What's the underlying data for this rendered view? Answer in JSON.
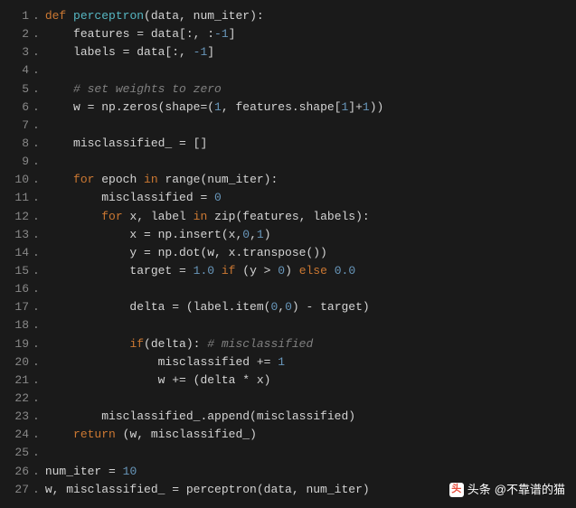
{
  "lines": [
    {
      "n": "1",
      "tokens": [
        {
          "t": "def ",
          "c": "keyword"
        },
        {
          "t": "perceptron",
          "c": "def-name"
        },
        {
          "t": "(data, num_iter):",
          "c": "plain"
        }
      ]
    },
    {
      "n": "2",
      "tokens": [
        {
          "t": "    features = data[:, :",
          "c": "plain"
        },
        {
          "t": "-1",
          "c": "number"
        },
        {
          "t": "]",
          "c": "plain"
        }
      ]
    },
    {
      "n": "3",
      "tokens": [
        {
          "t": "    labels = data[:, ",
          "c": "plain"
        },
        {
          "t": "-1",
          "c": "number"
        },
        {
          "t": "]",
          "c": "plain"
        }
      ]
    },
    {
      "n": "4",
      "tokens": []
    },
    {
      "n": "5",
      "tokens": [
        {
          "t": "    ",
          "c": "plain"
        },
        {
          "t": "# set weights to zero",
          "c": "comment"
        }
      ]
    },
    {
      "n": "6",
      "tokens": [
        {
          "t": "    w = np.zeros(shape=(",
          "c": "plain"
        },
        {
          "t": "1",
          "c": "number"
        },
        {
          "t": ", features.shape[",
          "c": "plain"
        },
        {
          "t": "1",
          "c": "number"
        },
        {
          "t": "]+",
          "c": "plain"
        },
        {
          "t": "1",
          "c": "number"
        },
        {
          "t": "))",
          "c": "plain"
        }
      ]
    },
    {
      "n": "7",
      "tokens": []
    },
    {
      "n": "8",
      "tokens": [
        {
          "t": "    misclassified_ = []",
          "c": "plain"
        }
      ]
    },
    {
      "n": "9",
      "tokens": []
    },
    {
      "n": "10",
      "tokens": [
        {
          "t": "    ",
          "c": "plain"
        },
        {
          "t": "for",
          "c": "keyword"
        },
        {
          "t": " epoch ",
          "c": "plain"
        },
        {
          "t": "in",
          "c": "keyword"
        },
        {
          "t": " range(num_iter):",
          "c": "plain"
        }
      ]
    },
    {
      "n": "11",
      "tokens": [
        {
          "t": "        misclassified = ",
          "c": "plain"
        },
        {
          "t": "0",
          "c": "number"
        }
      ]
    },
    {
      "n": "12",
      "tokens": [
        {
          "t": "        ",
          "c": "plain"
        },
        {
          "t": "for",
          "c": "keyword"
        },
        {
          "t": " x, label ",
          "c": "plain"
        },
        {
          "t": "in",
          "c": "keyword"
        },
        {
          "t": " zip(features, labels):",
          "c": "plain"
        }
      ]
    },
    {
      "n": "13",
      "tokens": [
        {
          "t": "            x = np.insert(x,",
          "c": "plain"
        },
        {
          "t": "0",
          "c": "number"
        },
        {
          "t": ",",
          "c": "plain"
        },
        {
          "t": "1",
          "c": "number"
        },
        {
          "t": ")",
          "c": "plain"
        }
      ]
    },
    {
      "n": "14",
      "tokens": [
        {
          "t": "            y = np.dot(w, x.transpose())",
          "c": "plain"
        }
      ]
    },
    {
      "n": "15",
      "tokens": [
        {
          "t": "            target = ",
          "c": "plain"
        },
        {
          "t": "1.0",
          "c": "number"
        },
        {
          "t": " ",
          "c": "plain"
        },
        {
          "t": "if",
          "c": "keyword"
        },
        {
          "t": " (y > ",
          "c": "plain"
        },
        {
          "t": "0",
          "c": "number"
        },
        {
          "t": ") ",
          "c": "plain"
        },
        {
          "t": "else",
          "c": "keyword"
        },
        {
          "t": " ",
          "c": "plain"
        },
        {
          "t": "0.0",
          "c": "number"
        }
      ]
    },
    {
      "n": "16",
      "tokens": []
    },
    {
      "n": "17",
      "tokens": [
        {
          "t": "            delta = (label.item(",
          "c": "plain"
        },
        {
          "t": "0",
          "c": "number"
        },
        {
          "t": ",",
          "c": "plain"
        },
        {
          "t": "0",
          "c": "number"
        },
        {
          "t": ") - target)",
          "c": "plain"
        }
      ]
    },
    {
      "n": "18",
      "tokens": []
    },
    {
      "n": "19",
      "tokens": [
        {
          "t": "            ",
          "c": "plain"
        },
        {
          "t": "if",
          "c": "keyword"
        },
        {
          "t": "(delta): ",
          "c": "plain"
        },
        {
          "t": "# misclassified",
          "c": "comment"
        }
      ]
    },
    {
      "n": "20",
      "tokens": [
        {
          "t": "                misclassified += ",
          "c": "plain"
        },
        {
          "t": "1",
          "c": "number"
        }
      ]
    },
    {
      "n": "21",
      "tokens": [
        {
          "t": "                w += (delta * x)",
          "c": "plain"
        }
      ]
    },
    {
      "n": "22",
      "tokens": []
    },
    {
      "n": "23",
      "tokens": [
        {
          "t": "        misclassified_.append(misclassified)",
          "c": "plain"
        }
      ]
    },
    {
      "n": "24",
      "tokens": [
        {
          "t": "    ",
          "c": "plain"
        },
        {
          "t": "return",
          "c": "keyword"
        },
        {
          "t": " (w, misclassified_)",
          "c": "plain"
        }
      ]
    },
    {
      "n": "25",
      "tokens": []
    },
    {
      "n": "26",
      "tokens": [
        {
          "t": "num_iter = ",
          "c": "plain"
        },
        {
          "t": "10",
          "c": "number"
        }
      ]
    },
    {
      "n": "27",
      "tokens": [
        {
          "t": "w, misclassified_ = perceptron(data, num_iter)",
          "c": "plain"
        }
      ]
    }
  ],
  "watermark": {
    "label": "头条",
    "handle": "@不靠谱的猫"
  }
}
